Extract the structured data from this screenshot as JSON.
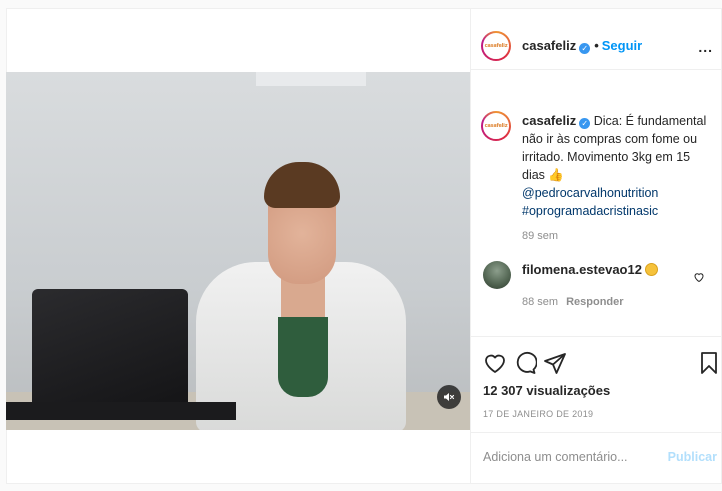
{
  "post": {
    "account": "casafeliz",
    "avatar_logo": "casafeliz",
    "separator": "•",
    "follow_label": "Seguir",
    "more_label": "...",
    "verified_mark": "✓"
  },
  "caption": {
    "username": "casafeliz",
    "text": "Dica: É fundamental não ir às compras com fome ou irritado. Movimento 3kg em 15 dias 👍",
    "mention": "@pedrocarvalhonutrition",
    "hashtag": "#oprogramadacristinasic",
    "time": "89 sem"
  },
  "comment": {
    "username": "filomena.estevao12",
    "time": "88 sem",
    "reply_label": "Responder"
  },
  "actions": {
    "views": "12 307 visualizações",
    "date": "17 DE JANEIRO DE 2019"
  },
  "add_comment": {
    "placeholder": "Adiciona um comentário...",
    "publish_label": "Publicar"
  },
  "colors": {
    "accent": "#0095f6",
    "publish_disabled": "#b2dffc",
    "verified": "#3897f0",
    "muted": "#8e8e8e"
  }
}
